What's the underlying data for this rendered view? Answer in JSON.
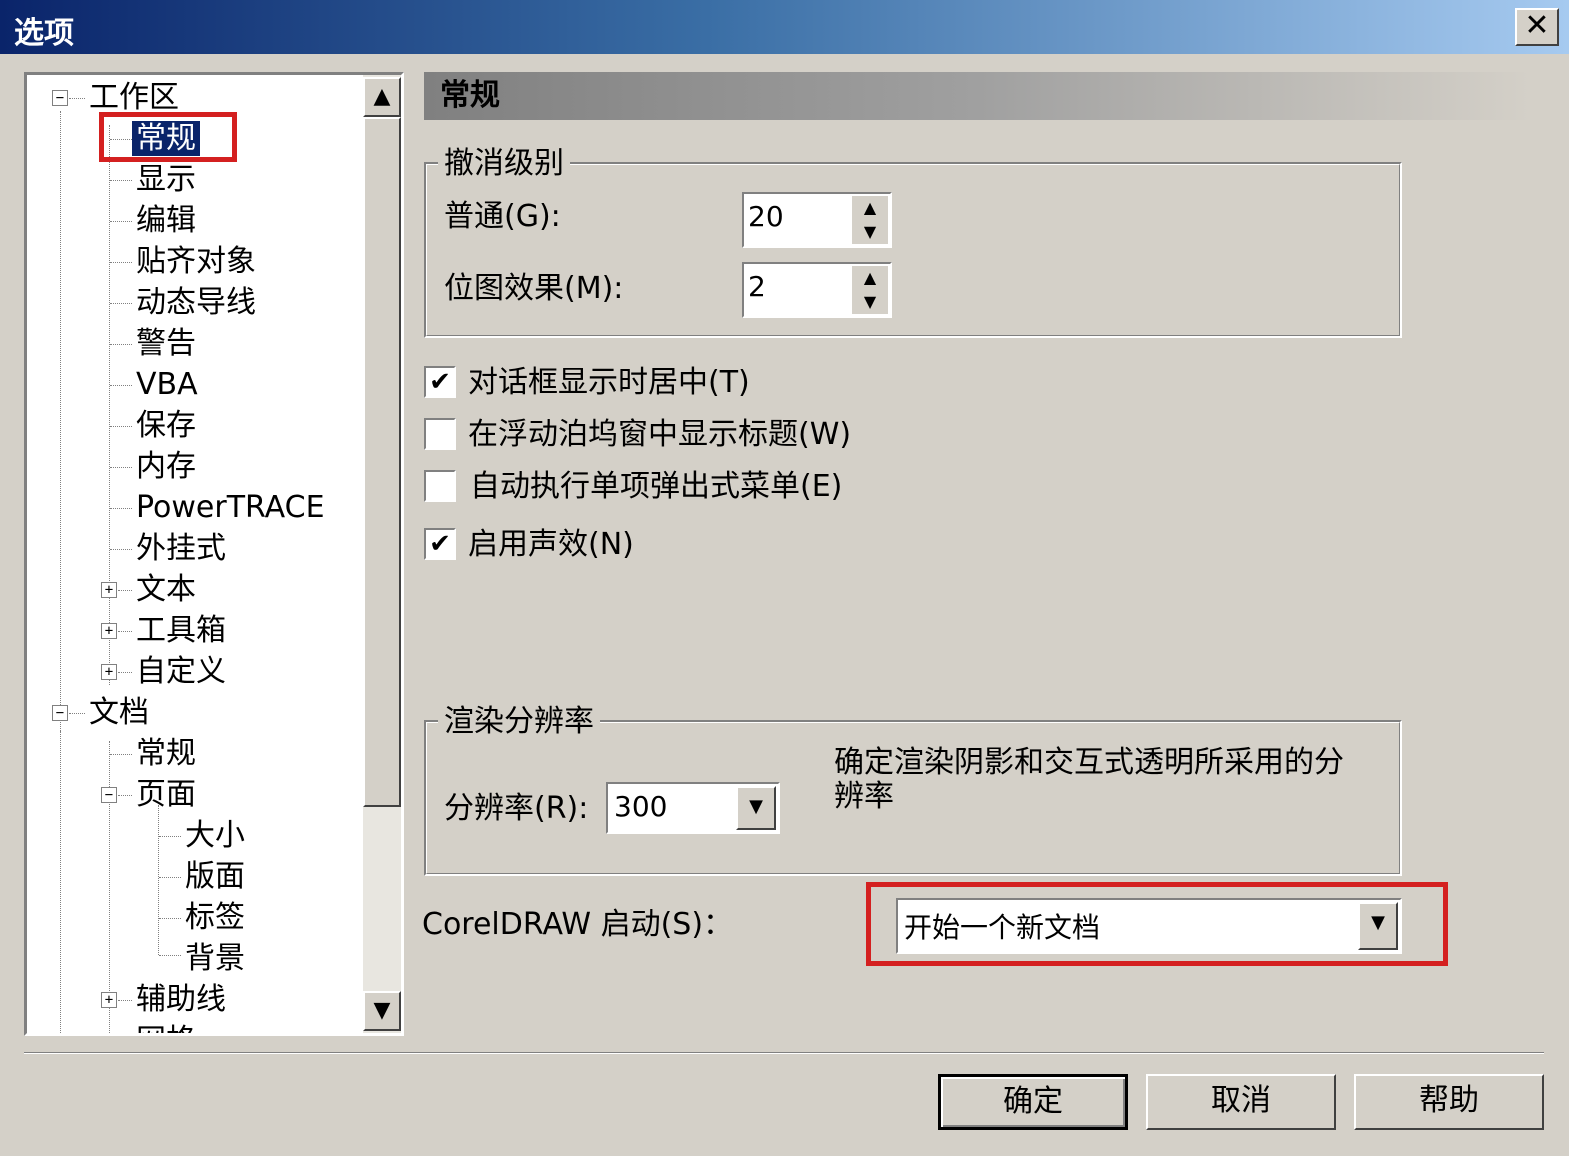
{
  "window": {
    "title": "选项",
    "close": "✕"
  },
  "tree": {
    "items": [
      {
        "label": "工作区",
        "expander": "−"
      },
      {
        "label": "常规"
      },
      {
        "label": "显示"
      },
      {
        "label": "编辑"
      },
      {
        "label": "贴齐对象"
      },
      {
        "label": "动态导线"
      },
      {
        "label": "警告"
      },
      {
        "label": "VBA"
      },
      {
        "label": "保存"
      },
      {
        "label": "内存"
      },
      {
        "label": "PowerTRACE"
      },
      {
        "label": "外挂式"
      },
      {
        "label": "文本",
        "expander": "+"
      },
      {
        "label": "工具箱",
        "expander": "+"
      },
      {
        "label": "自定义",
        "expander": "+"
      },
      {
        "label": "文档",
        "expander": "−"
      },
      {
        "label": "常规"
      },
      {
        "label": "页面",
        "expander": "−"
      },
      {
        "label": "大小"
      },
      {
        "label": "版面"
      },
      {
        "label": "标签"
      },
      {
        "label": "背景"
      },
      {
        "label": "辅助线",
        "expander": "+"
      },
      {
        "label": "网格"
      }
    ],
    "scroll_up": "▲",
    "scroll_down": "▼"
  },
  "section": {
    "title": "常规"
  },
  "undo": {
    "title": "撤消级别",
    "normal_label": "普通(G):",
    "normal_value": "20",
    "bitmap_label": "位图效果(M):",
    "bitmap_value": "2",
    "arrow_up": "▲",
    "arrow_down": "▼"
  },
  "checkboxes": [
    {
      "label": "对话框显示时居中(T)",
      "mark": "✔"
    },
    {
      "label": "在浮动泊坞窗中显示标题(W)",
      "mark": ""
    },
    {
      "label": "自动执行单项弹出式菜单(E)",
      "mark": ""
    },
    {
      "label": "启用声效(N)",
      "mark": "✔"
    }
  ],
  "render": {
    "title": "渲染分辨率",
    "resolution_label": "分辨率(R):",
    "resolution_value": "300",
    "description": "确定渲染阴影和交互式透明所采用的分辨率",
    "dropdown": "▼"
  },
  "startup": {
    "label": "CorelDRAW 启动(S)：",
    "value": "开始一个新文档",
    "dropdown": "▼"
  },
  "buttons": {
    "ok": "确定",
    "cancel": "取消",
    "help": "帮助"
  },
  "colors": {
    "highlight": "#d42020",
    "selection": "#0a246a"
  }
}
